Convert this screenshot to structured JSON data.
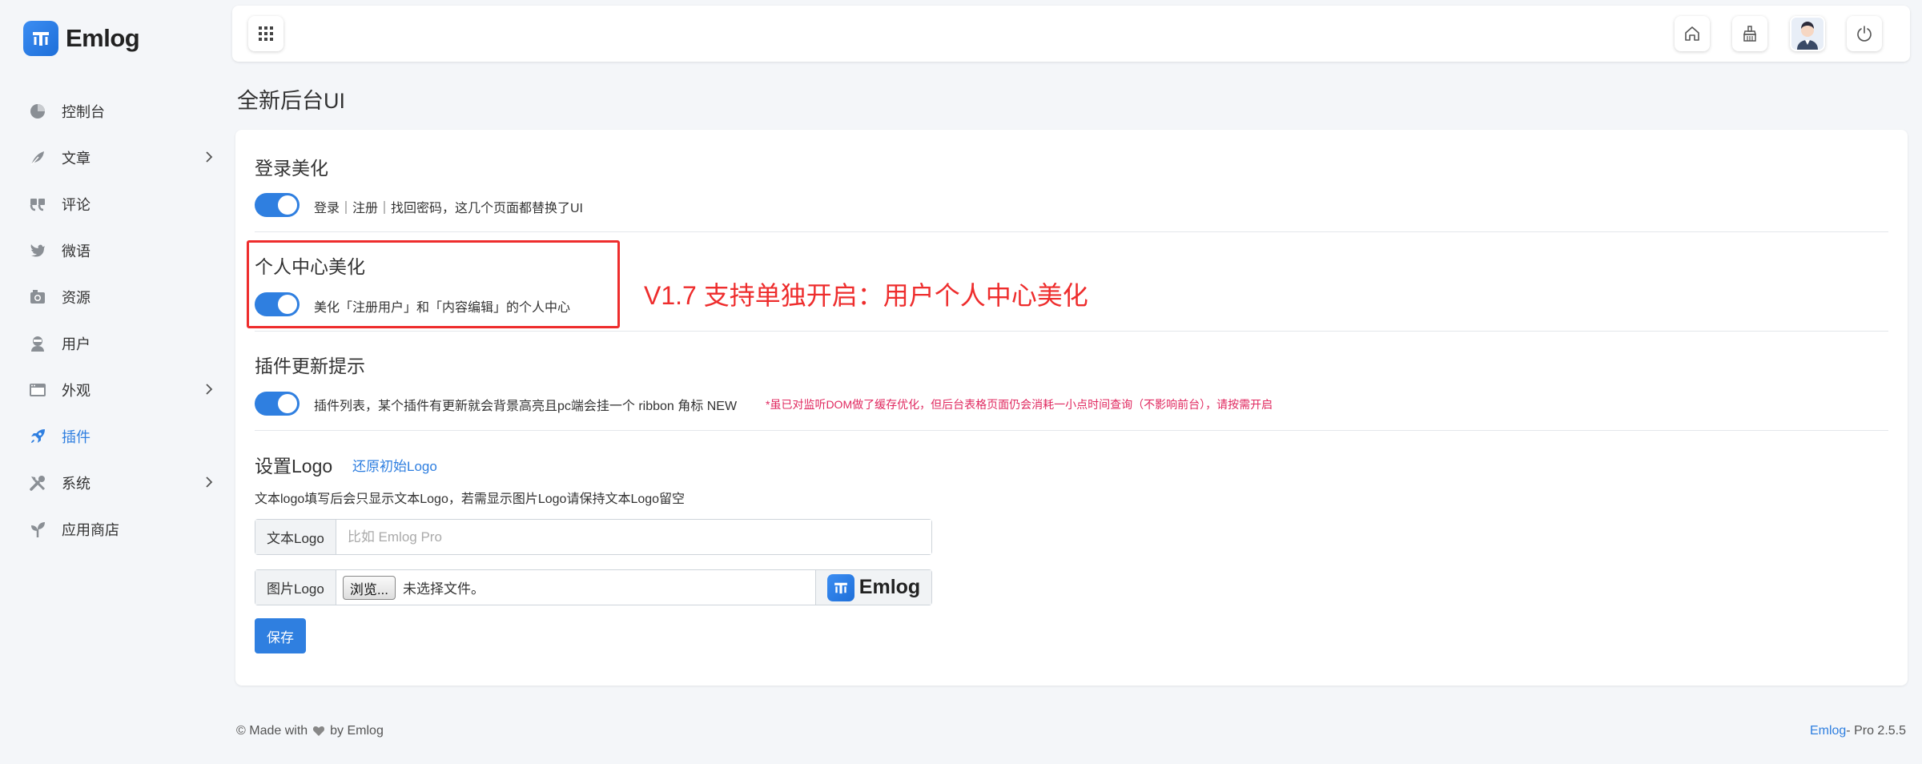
{
  "brand": {
    "name": "Emlog"
  },
  "sidebar": {
    "items": [
      {
        "label": "控制台",
        "icon": "dashboard-icon"
      },
      {
        "label": "文章",
        "icon": "feather-icon",
        "has_submenu": true
      },
      {
        "label": "评论",
        "icon": "quote-icon"
      },
      {
        "label": "微语",
        "icon": "bird-icon"
      },
      {
        "label": "资源",
        "icon": "camera-icon"
      },
      {
        "label": "用户",
        "icon": "user-icon"
      },
      {
        "label": "外观",
        "icon": "window-icon",
        "has_submenu": true
      },
      {
        "label": "插件",
        "icon": "rocket-icon",
        "active": true
      },
      {
        "label": "系统",
        "icon": "tools-icon",
        "has_submenu": true
      },
      {
        "label": "应用商店",
        "icon": "sprout-icon"
      }
    ]
  },
  "topbar": {
    "icons": [
      "grid-icon",
      "home-icon",
      "broom-icon",
      "avatar",
      "power-icon"
    ]
  },
  "page": {
    "title": "全新后台UI"
  },
  "sections": {
    "login": {
      "title": "登录美化",
      "desc": "登录｜注册｜找回密码，这几个页面都替换了UI",
      "enabled": true
    },
    "profile": {
      "title": "个人中心美化",
      "desc": "美化「注册用户」和「内容编辑」的个人中心",
      "enabled": true
    },
    "plugin_update": {
      "title": "插件更新提示",
      "desc": "插件列表，某个插件有更新就会背景高亮且pc端会挂一个 ribbon 角标 NEW",
      "warning": "*虽已对监听DOM做了缓存优化，但后台表格页面仍会消耗一小点时间查询（不影响前台），请按需开启",
      "enabled": true
    },
    "logo": {
      "title": "设置Logo",
      "restore_link": "还原初始Logo",
      "desc": "文本logo填写后会只显示文本Logo，若需显示图片Logo请保持文本Logo留空",
      "text_logo_label": "文本Logo",
      "text_logo_placeholder": "比如 Emlog Pro",
      "image_logo_label": "图片Logo",
      "browse_label": "浏览...",
      "no_file_text": "未选择文件。",
      "preview_text": "Emlog",
      "save_label": "保存"
    }
  },
  "annotation": {
    "text": "V1.7 支持单独开启：用户个人中心美化",
    "color": "#ee2d2d"
  },
  "footer": {
    "left_prefix": "© Made with",
    "left_suffix": "by Emlog",
    "right_brand": "Emlog",
    "right_version": "- Pro 2.5.5"
  },
  "colors": {
    "accent": "#2f7fe0",
    "warning": "#e0285f"
  }
}
